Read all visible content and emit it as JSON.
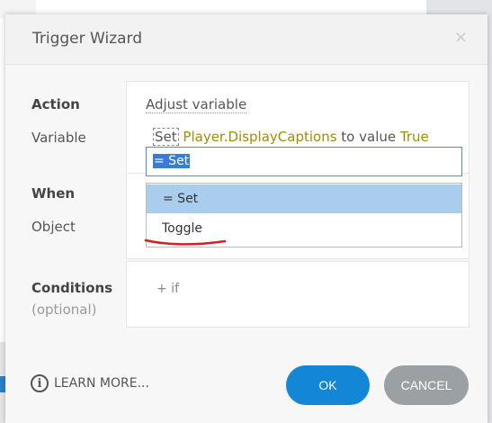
{
  "dialog": {
    "title": "Trigger Wizard",
    "close_glyph": "×"
  },
  "fields": {
    "action_label": "Action",
    "action_value": "Adjust variable",
    "variable_label": "Variable",
    "variable_line": {
      "set_word": "Set",
      "variable_name": "Player.DisplayCaptions",
      "middle_text": "to value",
      "value": "True"
    },
    "when_label": "When",
    "object_label": "Object",
    "conditions_label": "Conditions",
    "conditions_sub": "(optional)",
    "add_condition": "+ if"
  },
  "combo": {
    "input_value": "= Set",
    "options": [
      {
        "label": "= Set",
        "selected": true
      },
      {
        "label": "Toggle",
        "selected": false
      }
    ]
  },
  "footer": {
    "learn_more": "LEARN MORE...",
    "ok": "OK",
    "cancel": "CANCEL"
  },
  "icons": {
    "info": "info-icon",
    "close": "close-icon"
  },
  "colors": {
    "accent": "#1486d6",
    "cancel": "#9ba0a5",
    "variable_text": "#a08d00",
    "selected_option": "#aacdee",
    "annotation_stroke": "#d81f1f"
  }
}
